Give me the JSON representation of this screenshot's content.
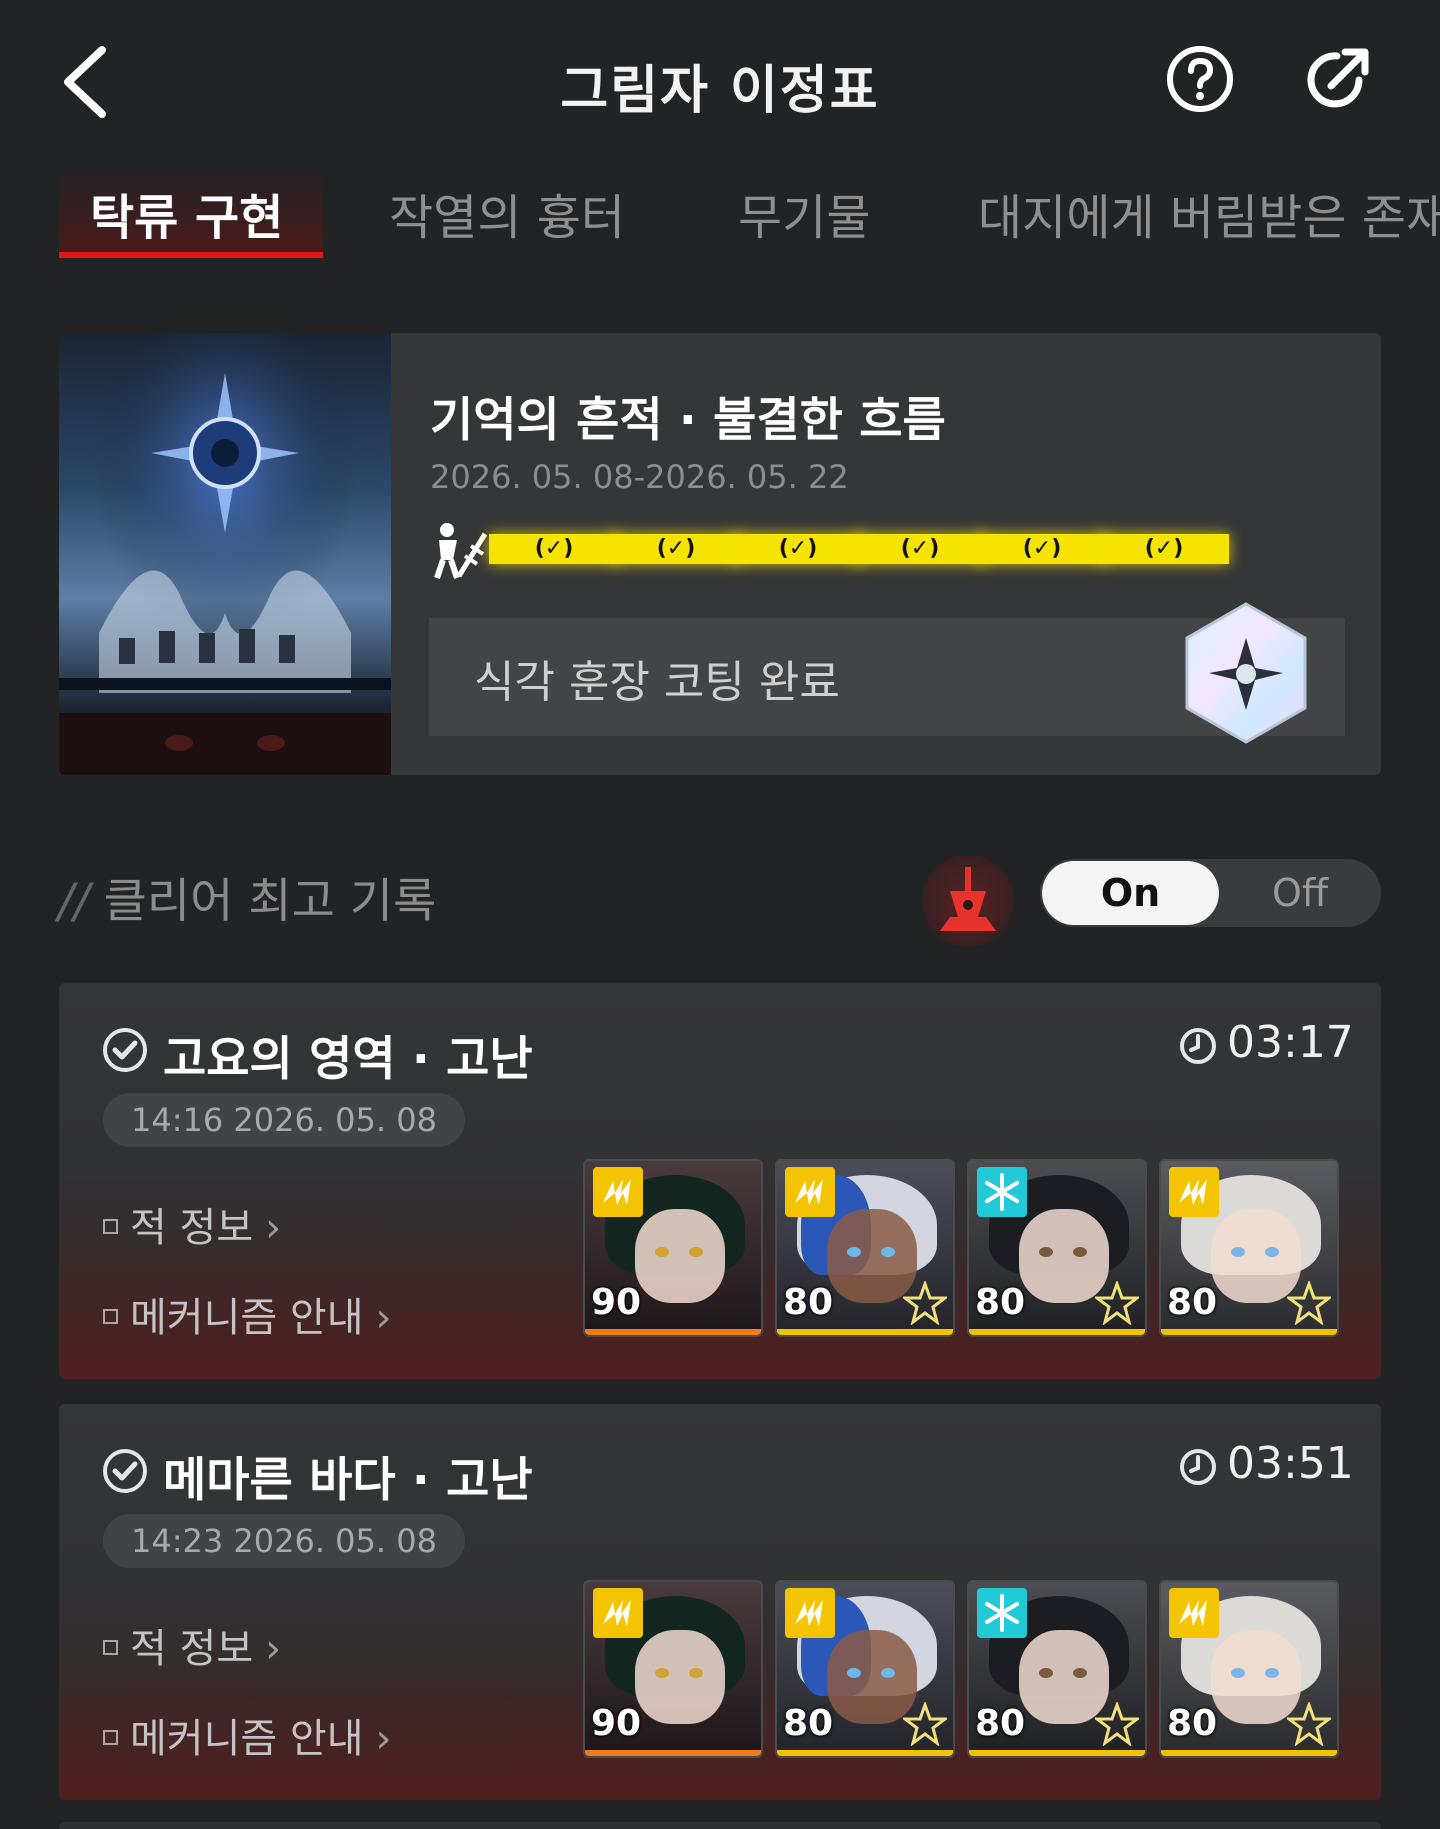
{
  "header": {
    "title": "그림자 이정표",
    "back_icon": "chevron-left-icon",
    "help_icon": "help-circle-icon",
    "share_icon": "share-icon"
  },
  "tabs": [
    {
      "label": "탁류 구현",
      "active": true
    },
    {
      "label": "작열의 흉터",
      "active": false
    },
    {
      "label": "무기물",
      "active": false
    },
    {
      "label": "대지에게 버림받은 존재",
      "active": false
    }
  ],
  "event": {
    "title": "기억의 흔적 · 불결한 흐름",
    "dates": "2026. 05. 08-2026. 05. 22",
    "difficulty_marks": [
      "(✓)",
      "(✓)",
      "(✓)",
      "(✓)",
      "(✓)",
      "(✓)"
    ],
    "medal_text": "식각 훈장 코팅 완료",
    "accent": "#f4e400"
  },
  "records_section": {
    "title": "클리어 최고 기록",
    "toggle_on": "On",
    "toggle_off": "Off",
    "toggle_state": "On"
  },
  "records": [
    {
      "stage": "고요의 영역 · 고난",
      "time": "03:17",
      "datetime": "14:16 2026. 05. 08",
      "links": [
        "적 정보",
        "메커니즘 안내"
      ],
      "team": [
        {
          "level": "90",
          "element": "lightning-icon"
        },
        {
          "level": "80",
          "element": "lightning-icon"
        },
        {
          "level": "80",
          "element": "snowflake-icon"
        },
        {
          "level": "80",
          "element": "lightning-icon"
        }
      ]
    },
    {
      "stage": "메마른 바다 · 고난",
      "time": "03:51",
      "datetime": "14:23 2026. 05. 08",
      "links": [
        "적 정보",
        "메커니즘 안내"
      ],
      "team": [
        {
          "level": "90",
          "element": "lightning-icon"
        },
        {
          "level": "80",
          "element": "lightning-icon"
        },
        {
          "level": "80",
          "element": "snowflake-icon"
        },
        {
          "level": "80",
          "element": "lightning-icon"
        }
      ]
    }
  ],
  "colors": {
    "background": "#222325",
    "tab_accent": "#e0161b",
    "lightning": "#f5c400",
    "ice": "#22c9d6",
    "level_bar_orange": "#f07d1a",
    "level_bar_gold": "#f2c200"
  }
}
